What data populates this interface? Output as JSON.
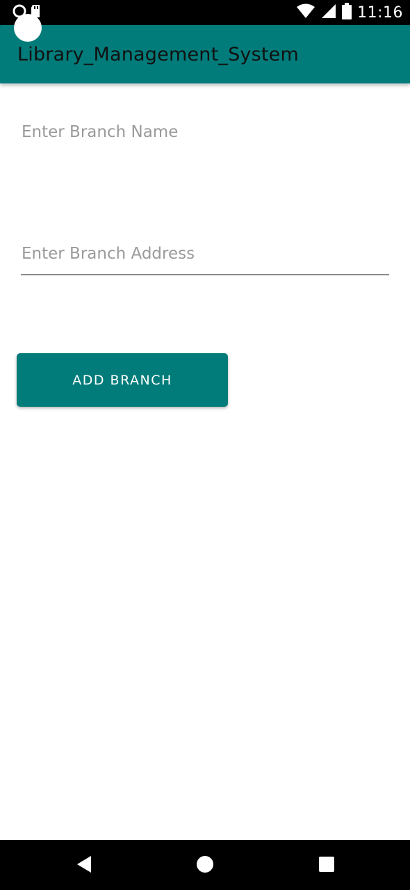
{
  "status_bar": {
    "time": "11:16",
    "icons": [
      "notification-dot-icon",
      "sd-card-icon",
      "wifi-icon",
      "signal-icon",
      "battery-icon"
    ]
  },
  "app_bar": {
    "title": "Library_Management_System",
    "background_color": "#017C7A"
  },
  "form": {
    "branch_name": {
      "placeholder": "Enter Branch Name",
      "value": ""
    },
    "branch_address": {
      "placeholder": "Enter Branch Address",
      "value": ""
    },
    "add_button_label": "ADD BRANCH"
  },
  "nav_bar": {
    "icons": [
      "back-icon",
      "home-icon",
      "recent-apps-icon"
    ]
  },
  "colors": {
    "accent": "#017C7A",
    "placeholder": "#9A9A9A"
  }
}
